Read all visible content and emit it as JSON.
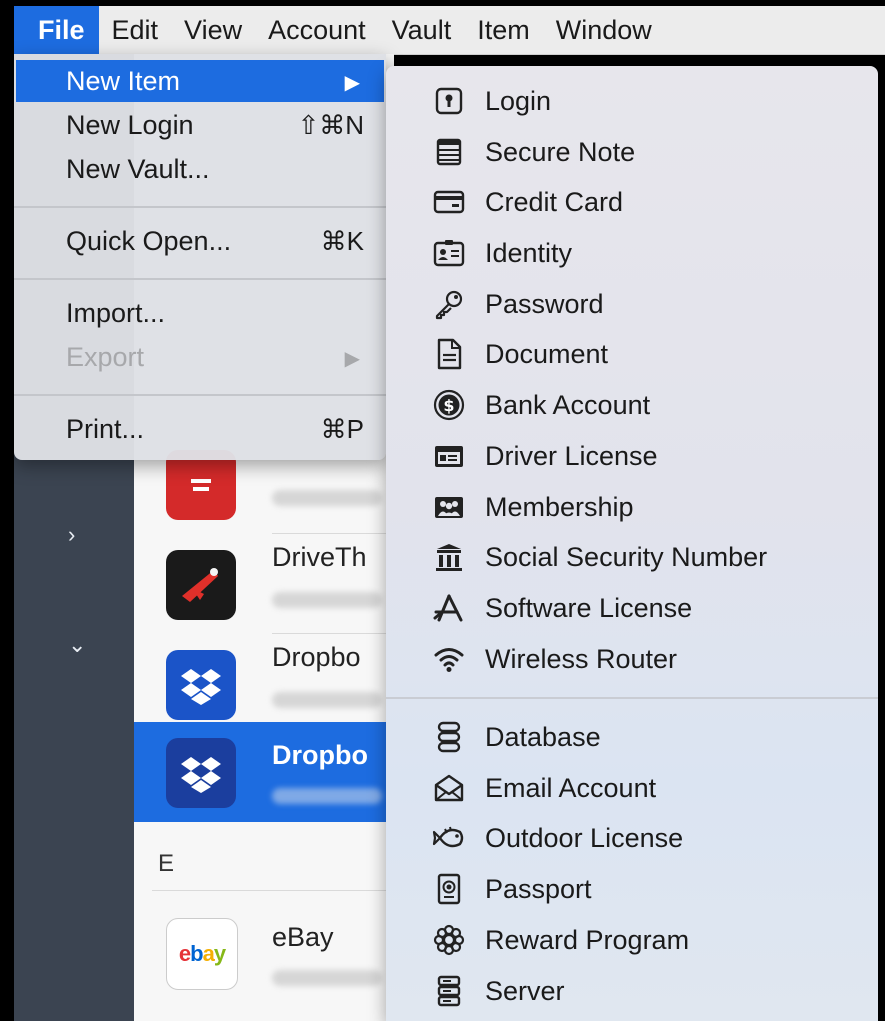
{
  "menubar": {
    "items": [
      {
        "label": "File",
        "active": true
      },
      {
        "label": "Edit"
      },
      {
        "label": "View"
      },
      {
        "label": "Account"
      },
      {
        "label": "Vault"
      },
      {
        "label": "Item"
      },
      {
        "label": "Window"
      }
    ]
  },
  "file_menu": {
    "items": [
      {
        "label": "New Item",
        "shortcut": "▶",
        "highlighted": true
      },
      {
        "label": "New Login",
        "shortcut": "⇧⌘N"
      },
      {
        "label": "New Vault..."
      },
      {
        "label": "Quick Open...",
        "shortcut": "⌘K"
      },
      {
        "label": "Import..."
      },
      {
        "label": "Export",
        "shortcut": "▶",
        "disabled": true
      },
      {
        "label": "Print...",
        "shortcut": "⌘P"
      }
    ]
  },
  "new_item_menu": {
    "items": [
      {
        "label": "Login",
        "icon": "login-icon"
      },
      {
        "label": "Secure Note",
        "icon": "secure-note-icon"
      },
      {
        "label": "Credit Card",
        "icon": "credit-card-icon"
      },
      {
        "label": "Identity",
        "icon": "identity-icon"
      },
      {
        "label": "Password",
        "icon": "password-key-icon"
      },
      {
        "label": "Document",
        "icon": "document-icon"
      },
      {
        "label": "Bank Account",
        "icon": "bank-account-icon"
      },
      {
        "label": "Driver License",
        "icon": "driver-license-icon"
      },
      {
        "label": "Membership",
        "icon": "membership-icon"
      },
      {
        "label": "Social Security Number",
        "icon": "social-security-icon"
      },
      {
        "label": "Software License",
        "icon": "software-license-icon"
      },
      {
        "label": "Wireless Router",
        "icon": "wifi-icon"
      },
      {
        "label": "Database",
        "icon": "database-icon"
      },
      {
        "label": "Email Account",
        "icon": "email-account-icon"
      },
      {
        "label": "Outdoor License",
        "icon": "outdoor-license-icon"
      },
      {
        "label": "Passport",
        "icon": "passport-icon"
      },
      {
        "label": "Reward Program",
        "icon": "reward-program-icon"
      },
      {
        "label": "Server",
        "icon": "server-icon"
      }
    ]
  },
  "item_list": {
    "rows": [
      {
        "title": "",
        "icon": "red-app-icon"
      },
      {
        "title": "DriveTh",
        "icon": "drivethru-icon"
      },
      {
        "title": "Dropbo",
        "icon": "dropbox-icon"
      },
      {
        "title": "Dropbo",
        "icon": "dropbox-icon",
        "selected": true
      },
      {
        "title": "eBay",
        "icon": "ebay-icon"
      }
    ],
    "section_header": "E",
    "ebay_logo_text": "ebay"
  },
  "sidebar": {
    "collapsed_chevron": "›",
    "expanded_chevron": "⌄"
  },
  "colors": {
    "accent": "#1d6ce0",
    "sidebar": "#3b4451",
    "menu_bg": "#dedfe4"
  }
}
